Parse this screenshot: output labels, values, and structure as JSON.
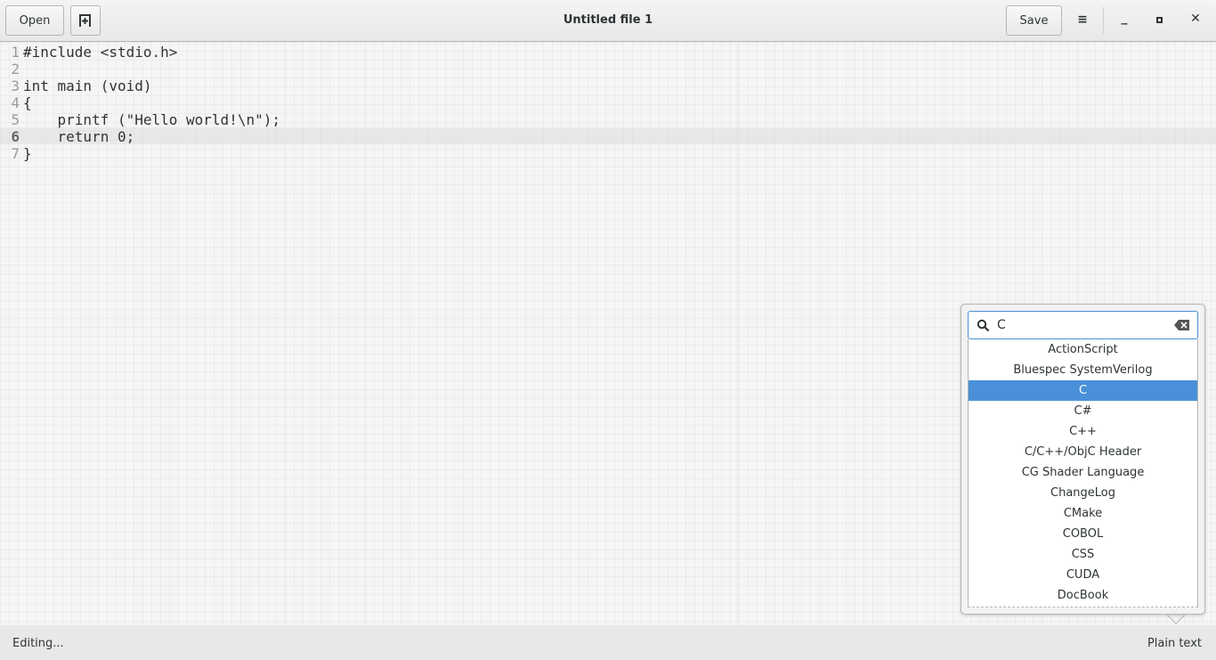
{
  "header": {
    "open_label": "Open",
    "title": "Untitled file 1",
    "save_label": "Save",
    "new_tab_icon": "new-document-icon",
    "menu_icon": "hamburger-menu-icon"
  },
  "editor": {
    "current_line": 6,
    "lines": [
      {
        "n": "1",
        "code": "#include <stdio.h>"
      },
      {
        "n": "2",
        "code": ""
      },
      {
        "n": "3",
        "code": "int main (void)"
      },
      {
        "n": "4",
        "code": "{"
      },
      {
        "n": "5",
        "code": "    printf (\"Hello world!\\n\");"
      },
      {
        "n": "6",
        "code": "    return 0;"
      },
      {
        "n": "7",
        "code": "}"
      }
    ]
  },
  "status": {
    "left": "Editing...",
    "language": "Plain text"
  },
  "language_popover": {
    "search_value": "C",
    "selected": "C",
    "items": [
      "ActionScript",
      "Bluespec SystemVerilog",
      "C",
      "C#",
      "C++",
      "C/C++/ObjC Header",
      "CG Shader Language",
      "ChangeLog",
      "CMake",
      "COBOL",
      "CSS",
      "CUDA",
      "DocBook"
    ]
  },
  "colors": {
    "accent": "#4a90d9"
  }
}
